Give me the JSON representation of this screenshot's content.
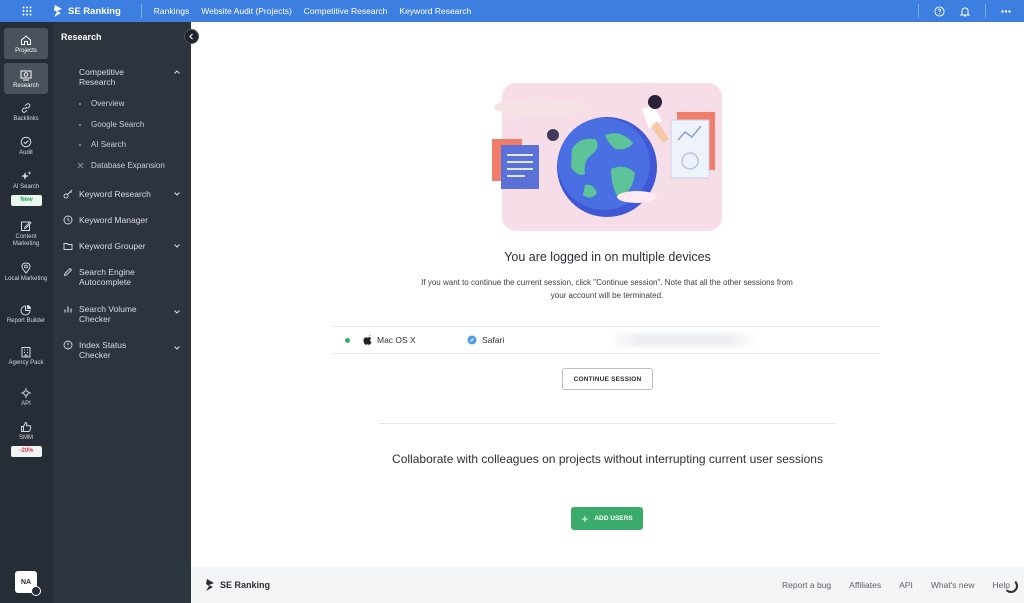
{
  "topbar": {
    "brand": "SE Ranking",
    "nav": [
      "Rankings",
      "Website Audit (Projects)",
      "Competitive Research",
      "Keyword Research"
    ]
  },
  "rail": {
    "items": [
      {
        "label": "Projects",
        "icon": "home-icon"
      },
      {
        "label": "Research",
        "icon": "research-icon"
      },
      {
        "label": "Backlinks",
        "icon": "link-icon"
      },
      {
        "label": "Audit",
        "icon": "check-circle-icon"
      },
      {
        "label": "AI Search",
        "icon": "sparkle-icon"
      },
      {
        "label": "Content Marketing",
        "icon": "edit-icon"
      },
      {
        "label": "Local Marketing",
        "icon": "pin-icon"
      },
      {
        "label": "Report Builder",
        "icon": "chart-pie-icon"
      },
      {
        "label": "Agency Pack",
        "icon": "building-icon"
      },
      {
        "label": "API",
        "icon": "api-icon"
      },
      {
        "label": "SMM",
        "icon": "thumbs-up-icon"
      }
    ],
    "ai_badge": "New",
    "smm_badge": "-20%",
    "avatar": "NA"
  },
  "subnav": {
    "title": "Research",
    "competitive": "Competitive Research",
    "sub_items": [
      "Overview",
      "Google Search",
      "AI Search",
      "Database Expansion"
    ],
    "items": [
      "Keyword Research",
      "Keyword Manager",
      "Keyword Grouper",
      "Search Engine Autocomplete",
      "Search Volume Checker",
      "Index Status Checker"
    ]
  },
  "main": {
    "heading": "You are logged in on multiple devices",
    "description": "If you want to continue the current session, click \"Continue session\". Note that all the other sessions from your account will be terminated.",
    "session": {
      "os": "Mac OS X",
      "browser": "Safari"
    },
    "continue_label": "CONTINUE SESSION",
    "collab_text": "Collaborate with colleagues on projects without interrupting current user sessions",
    "add_users_label": "ADD USERS"
  },
  "footer": {
    "brand": "SE Ranking",
    "links": [
      "Report a bug",
      "Affiliates",
      "API",
      "What's new",
      "Help"
    ]
  },
  "colors": {
    "accent": "#3d7fe0",
    "rail": "#262d36",
    "subnav": "#2c343e",
    "success": "#3aab6a"
  }
}
